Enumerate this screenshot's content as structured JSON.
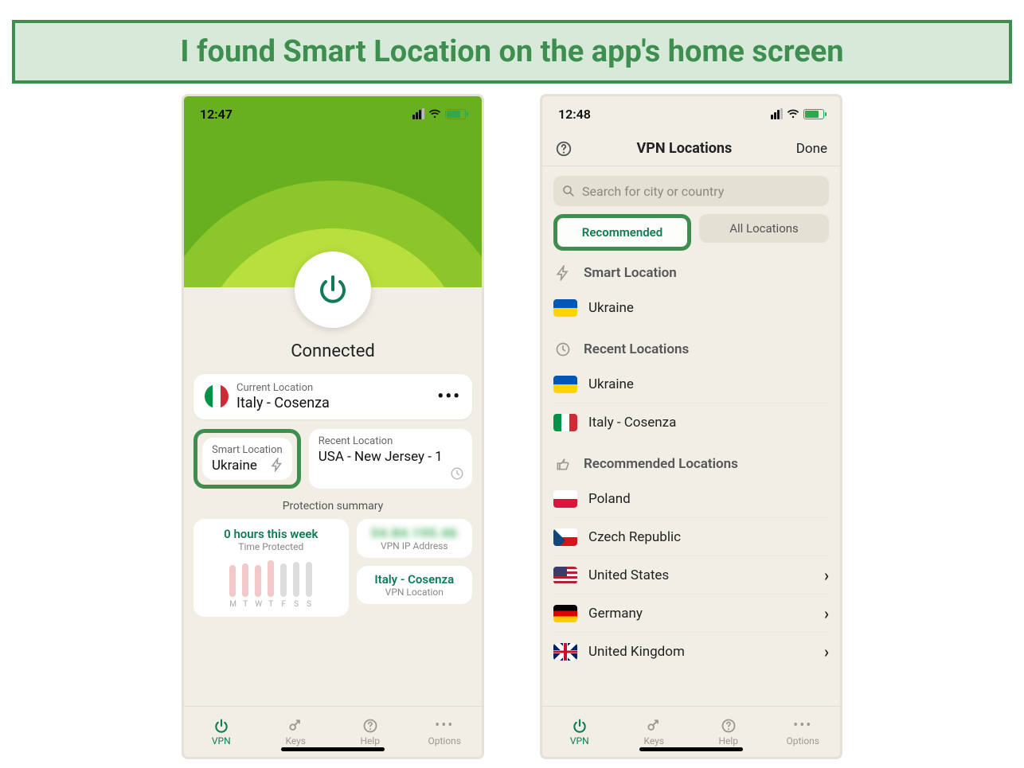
{
  "banner_text": "I found Smart Location on the app's home screen",
  "phone1": {
    "status": {
      "time": "12:47"
    },
    "connected_label": "Connected",
    "current": {
      "label": "Current Location",
      "value": "Italy - Cosenza"
    },
    "smart": {
      "label": "Smart Location",
      "value": "Ukraine"
    },
    "recent": {
      "label": "Recent Location",
      "value": "USA - New Jersey - 1"
    },
    "protection_label": "Protection summary",
    "hours_title": "0 hours this week",
    "hours_sub": "Time Protected",
    "days": [
      "M",
      "T",
      "W",
      "T",
      "F",
      "S",
      "S"
    ],
    "ip": {
      "label": "VPN IP Address"
    },
    "vpnloc": {
      "value": "Italy - Cosenza",
      "label": "VPN Location"
    },
    "tabs": {
      "vpn": "VPN",
      "keys": "Keys",
      "help": "Help",
      "options": "Options"
    }
  },
  "phone2": {
    "status": {
      "time": "12:48"
    },
    "title": "VPN Locations",
    "done": "Done",
    "search_placeholder": "Search for city or country",
    "seg": {
      "recommended": "Recommended",
      "all": "All Locations"
    },
    "smart": {
      "header": "Smart Location",
      "item": "Ukraine"
    },
    "recent": {
      "header": "Recent Locations",
      "items": [
        "Ukraine",
        "Italy - Cosenza"
      ]
    },
    "recommended": {
      "header": "Recommended Locations",
      "items": [
        "Poland",
        "Czech Republic",
        "United States",
        "Germany",
        "United Kingdom"
      ]
    },
    "tabs": {
      "vpn": "VPN",
      "keys": "Keys",
      "help": "Help",
      "options": "Options"
    }
  }
}
